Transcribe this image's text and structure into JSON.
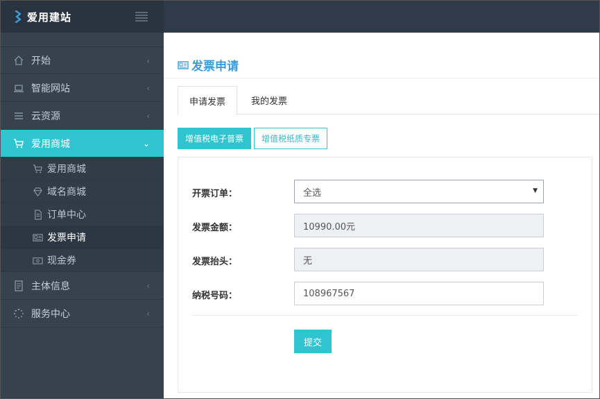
{
  "app": {
    "title": "爱用建站"
  },
  "sidebar": {
    "items": [
      {
        "label": "开始",
        "icon": "home-icon"
      },
      {
        "label": "智能网站",
        "icon": "laptop-icon"
      },
      {
        "label": "云资源",
        "icon": "list-icon"
      },
      {
        "label": "爱用商城",
        "icon": "cart-icon",
        "expanded": true
      },
      {
        "label": "主体信息",
        "icon": "id-card-icon"
      },
      {
        "label": "服务中心",
        "icon": "spinner-icon"
      }
    ],
    "sub_items": [
      {
        "label": "爱用商城",
        "icon": "cart-icon"
      },
      {
        "label": "域名商城",
        "icon": "diamond-icon"
      },
      {
        "label": "订单中心",
        "icon": "document-icon"
      },
      {
        "label": "发票申请",
        "icon": "invoice-icon",
        "active": true
      },
      {
        "label": "现金券",
        "icon": "cash-icon"
      }
    ]
  },
  "page": {
    "title": "发票申请"
  },
  "tabs": [
    {
      "label": "申请发票",
      "active": true
    },
    {
      "label": "我的发票"
    }
  ],
  "invoice_types": [
    {
      "label": "增值税电子普票",
      "active": true
    },
    {
      "label": "增值税纸质专票"
    }
  ],
  "form": {
    "order_label": "开票订单：",
    "order_value": "全选",
    "amount_label": "发票金额：",
    "amount_value": "10990.00元",
    "header_label": "发票抬头：",
    "header_value": "无",
    "tax_label": "纳税号码：",
    "tax_value": "108967567",
    "submit_label": "提交"
  },
  "colors": {
    "accent": "#2fc4d0",
    "sidebar_bg": "#37424f",
    "title_blue": "#3b9bd4"
  }
}
